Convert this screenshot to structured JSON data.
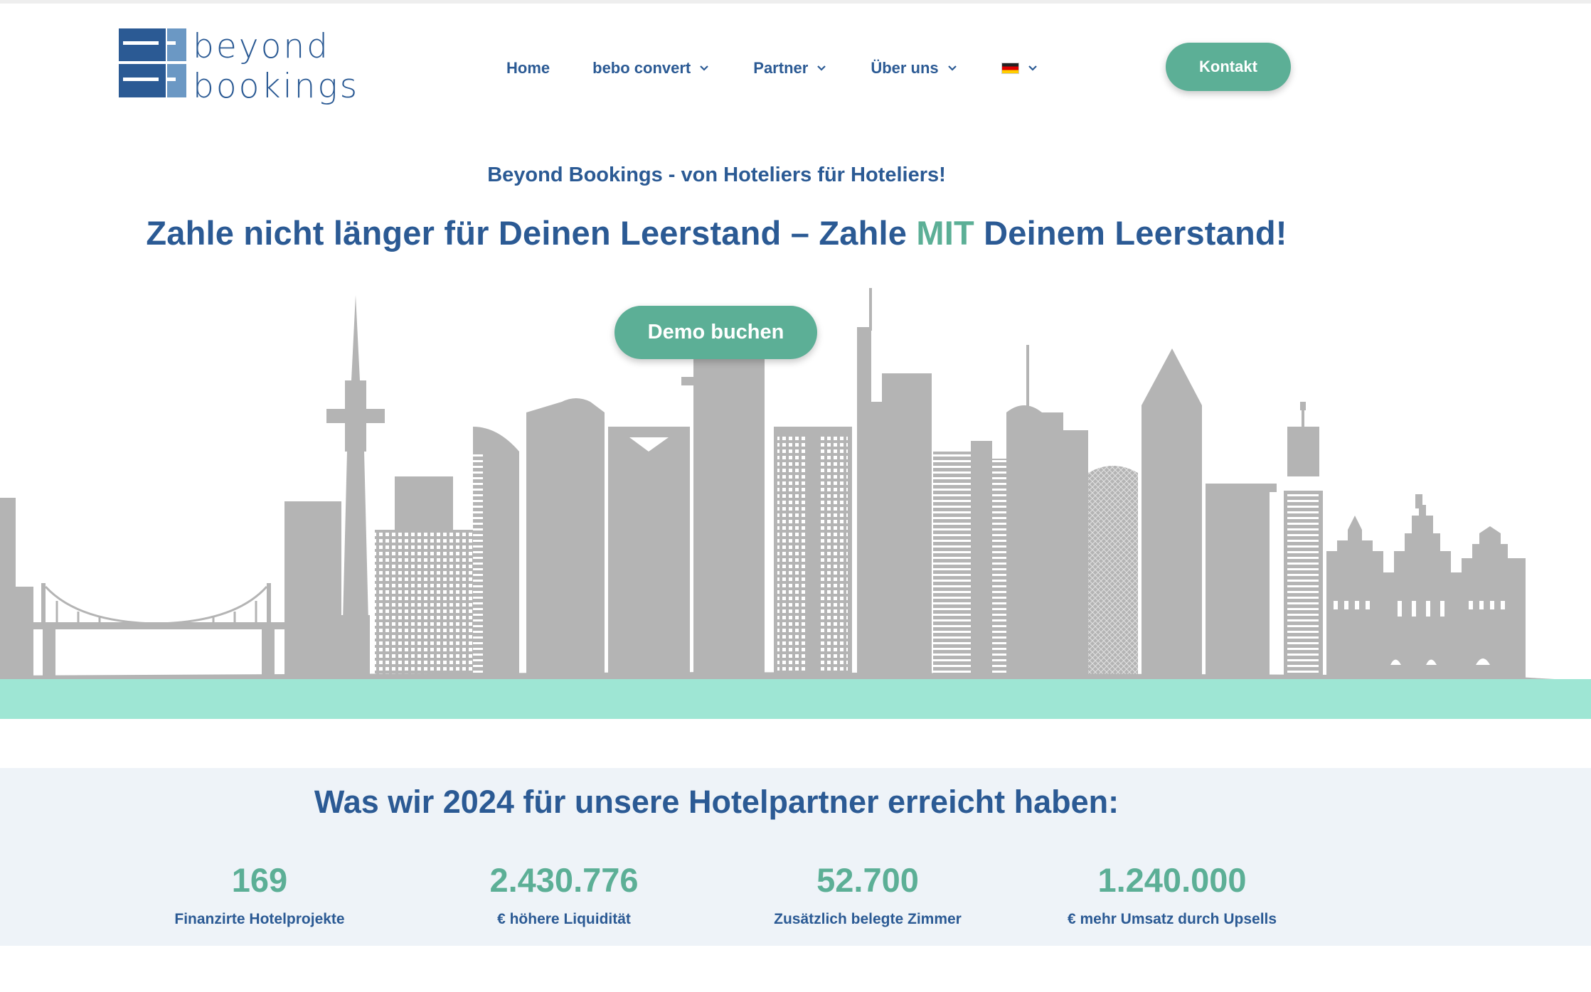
{
  "header": {
    "logo": {
      "line1": "beyond",
      "line2": "bookings"
    },
    "nav": [
      {
        "label": "Home",
        "has_dropdown": false
      },
      {
        "label": "bebo convert",
        "has_dropdown": true
      },
      {
        "label": "Partner",
        "has_dropdown": true
      },
      {
        "label": "Über uns",
        "has_dropdown": true
      }
    ],
    "language": {
      "icon": "flag-de-icon",
      "has_dropdown": true
    },
    "cta_label": "Kontakt"
  },
  "hero": {
    "tagline": "Beyond Bookings - von Hoteliers für Hoteliers!",
    "headline_part1": "Zahle nicht länger für Deinen Leerstand – Zahle ",
    "headline_accent": "MIT",
    "headline_part2": " Deinem Leerstand!",
    "cta_label": "Demo buchen",
    "image": "frankfurt-skyline-illustration"
  },
  "stats": {
    "title": "Was wir 2024 für unsere Hotelpartner erreicht haben:",
    "items": [
      {
        "value": "169",
        "label": "Finanzirte Hotelprojekte"
      },
      {
        "value": "2.430.776",
        "label": "€ höhere Liquidität"
      },
      {
        "value": "52.700",
        "label": "Zusätzlich belegte Zimmer"
      },
      {
        "value": "1.240.000",
        "label": "€ mehr Umsatz durch Upsells"
      }
    ]
  },
  "colors": {
    "brand_blue": "#2b5a94",
    "accent_green": "#5caf96",
    "mint_band": "#9ee6d4",
    "skyline_gray": "#b4b4b4",
    "stats_bg": "#eef3f8"
  }
}
